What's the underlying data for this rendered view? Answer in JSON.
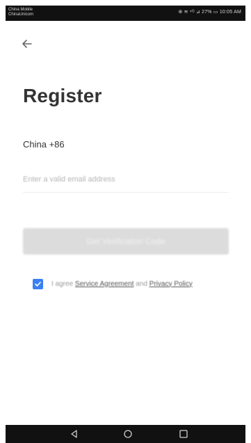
{
  "status_bar": {
    "carrier_line1": "China Mobile",
    "carrier_line2": "ChinaUnicom",
    "right_text": "⊕ ≋ ⁴ᴳ ⊿ 27% ▭ 10:05 AM"
  },
  "header": {
    "back_icon": "arrow-left-icon"
  },
  "page": {
    "title": "Register"
  },
  "form": {
    "country_label": "China +86",
    "email_placeholder": "Enter a valid email address",
    "submit_label": "Get Verification Code"
  },
  "agreement": {
    "prefix": "I agree",
    "service_link": "Service Agreement",
    "conjunction": "and",
    "privacy_link": "Privacy Policy",
    "checked": true
  },
  "nav_bar": {
    "back_icon": "triangle-back-icon",
    "home_icon": "circle-home-icon",
    "recent_icon": "square-recents-icon"
  },
  "colors": {
    "accent": "#3b7ff2",
    "title": "#333333",
    "button_disabled": "#dcdcdc"
  }
}
